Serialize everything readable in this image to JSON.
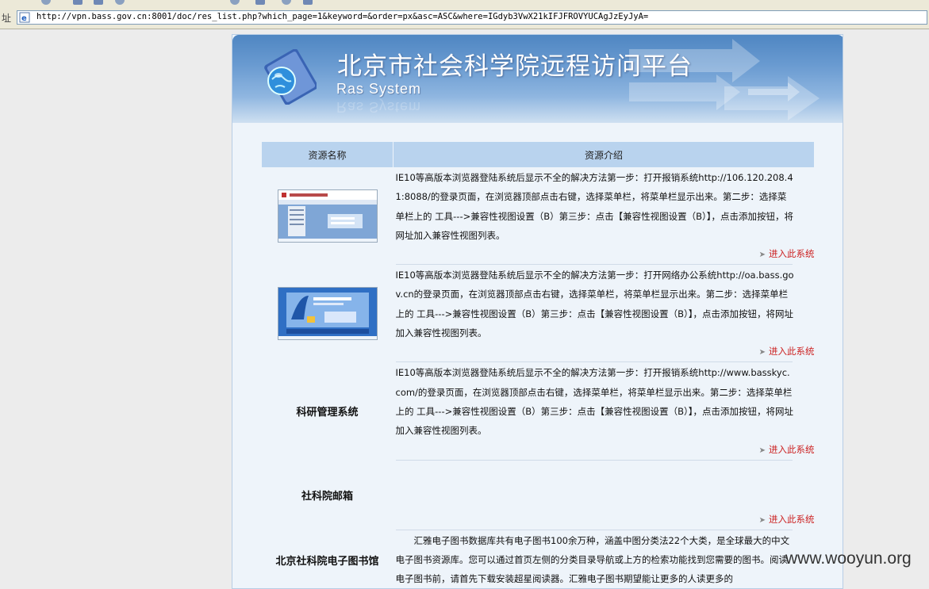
{
  "browser": {
    "address_label": "址",
    "url": "http://vpn.bass.gov.cn:8001/doc/res_list.php?which_page=1&keyword=&order=px&asc=ASC&where=IGdyb3VwX21kIFJFROVYUCAgJzEyJyA="
  },
  "header": {
    "title": "北京市社会科学院远程访问平台",
    "subtitle": "Ras System"
  },
  "table": {
    "col_name": "资源名称",
    "col_desc": "资源介绍",
    "link_label": "进入此系统",
    "rows": [
      {
        "name": "",
        "thumb": "finance-system-thumbnail",
        "desc": "IE10等高版本浏览器登陆系统后显示不全的解决方法第一步：打开报销系统http://106.120.208.41:8088/的登录页面，在浏览器顶部点击右键，选择菜单栏，将菜单栏显示出来。第二步：选择菜单栏上的 工具--->兼容性视图设置（B）第三步：点击【兼容性视图设置（B）】，点击添加按钮，将网址加入兼容性视图列表。"
      },
      {
        "name": "",
        "thumb": "office-automation-thumbnail",
        "desc": "IE10等高版本浏览器登陆系统后显示不全的解决方法第一步：打开网络办公系统http://oa.bass.gov.cn的登录页面，在浏览器顶部点击右键，选择菜单栏，将菜单栏显示出来。第二步：选择菜单栏上的 工具--->兼容性视图设置（B）第三步：点击【兼容性视图设置（B）】，点击添加按钮，将网址加入兼容性视图列表。"
      },
      {
        "name": "科研管理系统",
        "desc": "IE10等高版本浏览器登陆系统后显示不全的解决方法第一步：打开报销系统http://www.basskyc.com/的登录页面，在浏览器顶部点击右键，选择菜单栏，将菜单栏显示出来。第二步：选择菜单栏上的 工具--->兼容性视图设置（B）第三步：点击【兼容性视图设置（B）】，点击添加按钮，将网址加入兼容性视图列表。"
      },
      {
        "name": "社科院邮箱",
        "desc": ""
      },
      {
        "name": "北京社科院电子图书馆",
        "desc": "汇雅电子图书数据库共有电子图书100余万种，涵盖中图分类法22个大类，是全球最大的中文电子图书资源库。您可以通过首页左侧的分类目录导航或上方的检索功能找到您需要的图书。阅读电子图书前，请首先下载安装超星阅读器。汇雅电子图书期望能让更多的人读更多的"
      }
    ]
  },
  "watermark": "www.wooyun.org",
  "colors": {
    "table_header_bg": "#b9d3ee",
    "link": "#cc2222",
    "banner": "#5b8fc8"
  }
}
